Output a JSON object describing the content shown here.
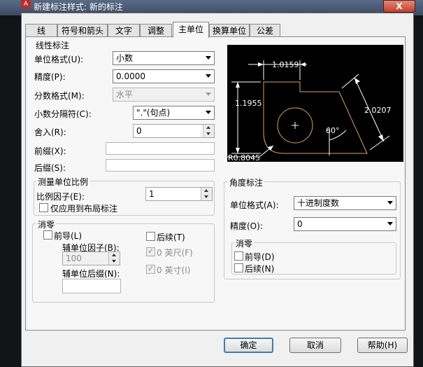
{
  "window": {
    "title": "新建标注样式: 新的标注",
    "close": "X"
  },
  "tabs": [
    "线",
    "符号和箭头",
    "文字",
    "调整",
    "主单位",
    "换算单位",
    "公差"
  ],
  "linear": {
    "group_title": "线性标注",
    "unit_format_label": "单位格式(U):",
    "unit_format_value": "小数",
    "precision_label": "精度(P):",
    "precision_value": "0.0000",
    "fraction_label": "分数格式(M):",
    "fraction_value": "水平",
    "decimal_sep_label": "小数分隔符(C):",
    "decimal_sep_value": "\".\"(句点)",
    "roundoff_label": "舍入(R):",
    "roundoff_value": "0",
    "prefix_label": "前缀(X):",
    "prefix_value": "",
    "suffix_label": "后缀(S):",
    "suffix_value": ""
  },
  "scale": {
    "group_title": "测量单位比例",
    "factor_label": "比例因子(E):",
    "factor_value": "1",
    "layout_only_label": "仅应用到布局标注"
  },
  "zero": {
    "group_title": "消零",
    "leading_label": "前导(L)",
    "sub_factor_label": "辅单位因子(B):",
    "sub_factor_value": "100",
    "sub_suffix_label": "辅单位后缀(N):",
    "sub_suffix_value": "",
    "trailing_label": "后续(T)",
    "feet_label": "0 英尺(F)",
    "inches_label": "0 英寸(I)"
  },
  "angular": {
    "group_title": "角度标注",
    "unit_format_label": "单位格式(A):",
    "unit_format_value": "十进制度数",
    "precision_label": "精度(O):",
    "precision_value": "0",
    "zero_title": "消零",
    "leading_label": "前导(D)",
    "trailing_label": "后续(N)"
  },
  "preview": {
    "dim_top": "1.0159",
    "dim_left": "1.1955",
    "dim_right": "2.0207",
    "angle": "60°",
    "radius": "R0.8045",
    "colors": {
      "background": "#000000",
      "geometry": "#d9a066",
      "dims": "#ffffff"
    }
  },
  "buttons": {
    "ok": "确定",
    "cancel": "取消",
    "help": "帮助(H)"
  }
}
